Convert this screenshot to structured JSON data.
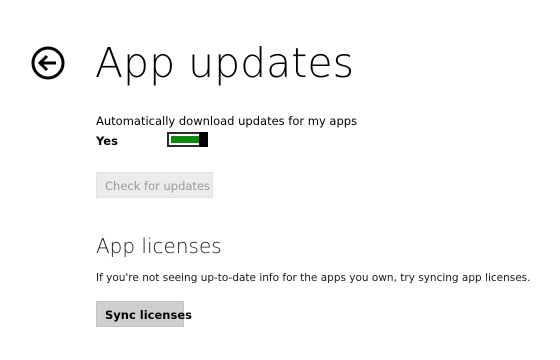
{
  "header": {
    "back_icon": "back-arrow-circle-icon",
    "title": "App updates"
  },
  "auto_update": {
    "label": "Automatically download updates for my apps",
    "state_label": "Yes",
    "enabled": true,
    "toggle_on_color": "#0b8a0b"
  },
  "check_button": {
    "label": "Check for updates",
    "disabled": true
  },
  "licenses": {
    "title": "App licenses",
    "description": "If you're not seeing up-to-date info for the apps you own, try syncing app licenses.",
    "sync_button_label": "Sync licenses"
  }
}
